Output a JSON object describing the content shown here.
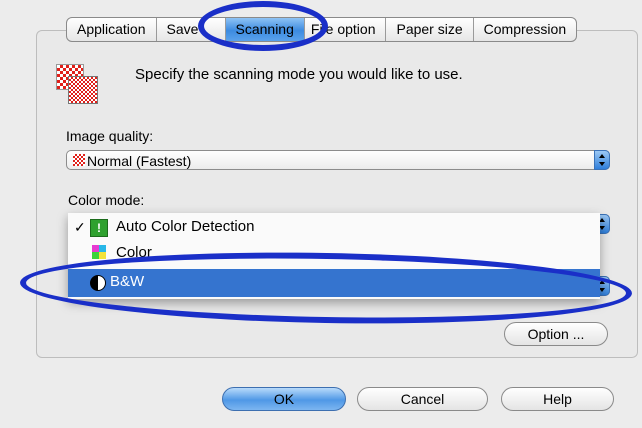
{
  "tabs": [
    {
      "label": "Application"
    },
    {
      "label": "Save"
    },
    {
      "label": "Scanning"
    },
    {
      "label": "File option"
    },
    {
      "label": "Paper size"
    },
    {
      "label": "Compression"
    }
  ],
  "active_tab": "Scanning",
  "header": {
    "description": "Specify the scanning mode you would like to use.",
    "icon": "checkerboard-scan-icon"
  },
  "image_quality": {
    "label": "Image quality:",
    "value": "Normal  (Fastest)",
    "icon": "checker-quality-icon"
  },
  "color_mode": {
    "label": "Color mode:",
    "menu": [
      {
        "label": "Auto Color Detection",
        "checked": true,
        "icon": "auto-color-icon"
      },
      {
        "label": "Color",
        "checked": false,
        "icon": "color-cube-icon"
      },
      {
        "label": "B&W",
        "checked": false,
        "selected": true,
        "icon": "bw-icon"
      }
    ]
  },
  "buttons": {
    "option": "Option ...",
    "ok": "OK",
    "cancel": "Cancel",
    "help": "Help"
  },
  "colors": {
    "accent": "#3574cf",
    "annotation": "#1a2fc8",
    "checker_red": "#e0201a"
  }
}
